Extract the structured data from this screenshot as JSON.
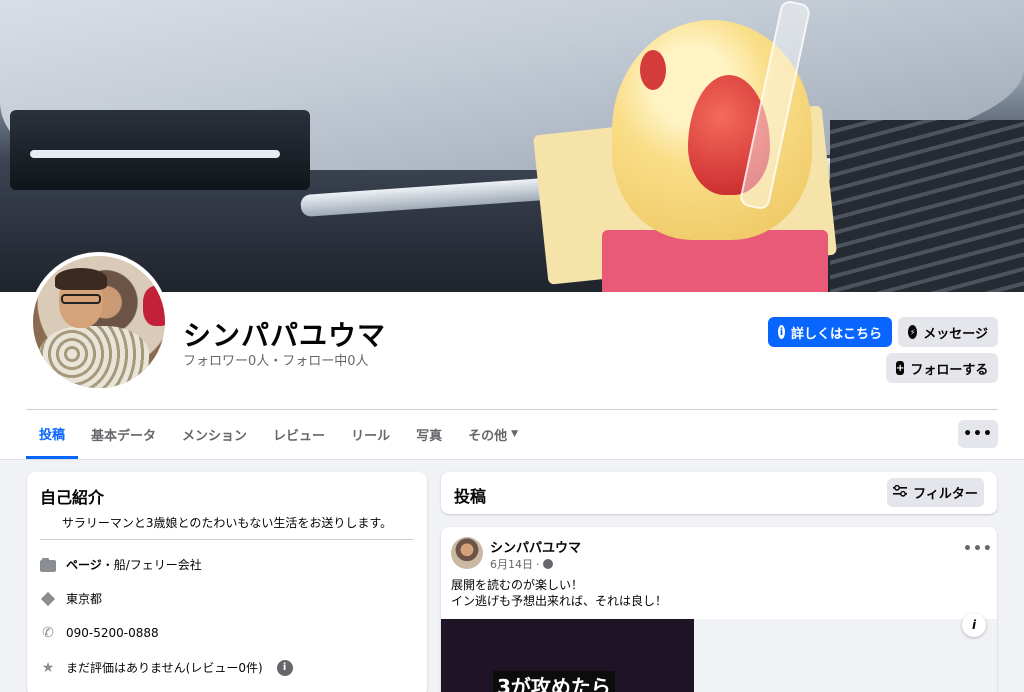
{
  "profile": {
    "name": "シンパパユウマ",
    "followers_line": "フォロワー0人・フォロー中0人"
  },
  "actions": {
    "learn_more": "詳しくはこちら",
    "message": "メッセージ",
    "follow": "フォローする"
  },
  "tabs": [
    {
      "label": "投稿",
      "active": true
    },
    {
      "label": "基本データ"
    },
    {
      "label": "メンション"
    },
    {
      "label": "レビュー"
    },
    {
      "label": "リール"
    },
    {
      "label": "写真"
    },
    {
      "label": "その他"
    }
  ],
  "tab_more_caret": "▼",
  "more_menu": "•••",
  "intro": {
    "title": "自己紹介",
    "bio": "サラリーマンと3歳娘とのたわいもない生活をお送りします。",
    "rows": [
      {
        "icon": "page-icon",
        "bold": "ページ",
        "text": "・船/フェリー会社"
      },
      {
        "icon": "location-icon",
        "text": "東京都"
      },
      {
        "icon": "phone-icon",
        "text": "090-5200-0888"
      },
      {
        "icon": "star-icon",
        "text": "まだ評価はありません(レビュー0件)"
      }
    ]
  },
  "posts": {
    "title": "投稿",
    "filter_label": "フィルター"
  },
  "post": {
    "author": "シンパパユウマ",
    "date": "6月14日",
    "line1": "展開を読むのが楽しい！",
    "line2": "イン逃げも予想出来れば、それは良し！",
    "media_caption": "3が攻めたら",
    "more": "•••"
  },
  "colors": {
    "accent": "#0866ff",
    "background": "#f0f2f5",
    "button_gray": "#e4e6eb"
  }
}
